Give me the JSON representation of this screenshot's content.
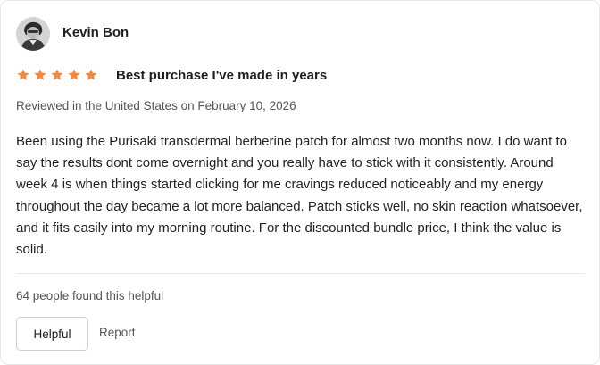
{
  "review": {
    "author": "Kevin Bon",
    "rating": 5,
    "rating_max": 5,
    "title": "Best purchase I've made in years",
    "meta": "Reviewed in the United States on February 10, 2026",
    "body": "Been using the Purisaki transdermal berberine patch for almost two months now. I do want to say the results dont come overnight and you really have to stick with it consistently. Around week 4 is when things started clicking for me cravings reduced noticeably and my energy throughout the day became a lot more balanced. Patch sticks well, no skin reaction whatsoever, and it fits easily into my morning routine. For the discounted bundle price, I think the value is solid.",
    "helpful_count_text": "64 people found this helpful"
  },
  "actions": {
    "helpful_label": "Helpful",
    "report_label": "Report"
  },
  "colors": {
    "star": "#f4883a",
    "text": "#1f1f1f",
    "muted": "#555555",
    "border": "#e6e6e6"
  },
  "icons": {
    "star": "star-icon",
    "avatar": "user-avatar"
  }
}
